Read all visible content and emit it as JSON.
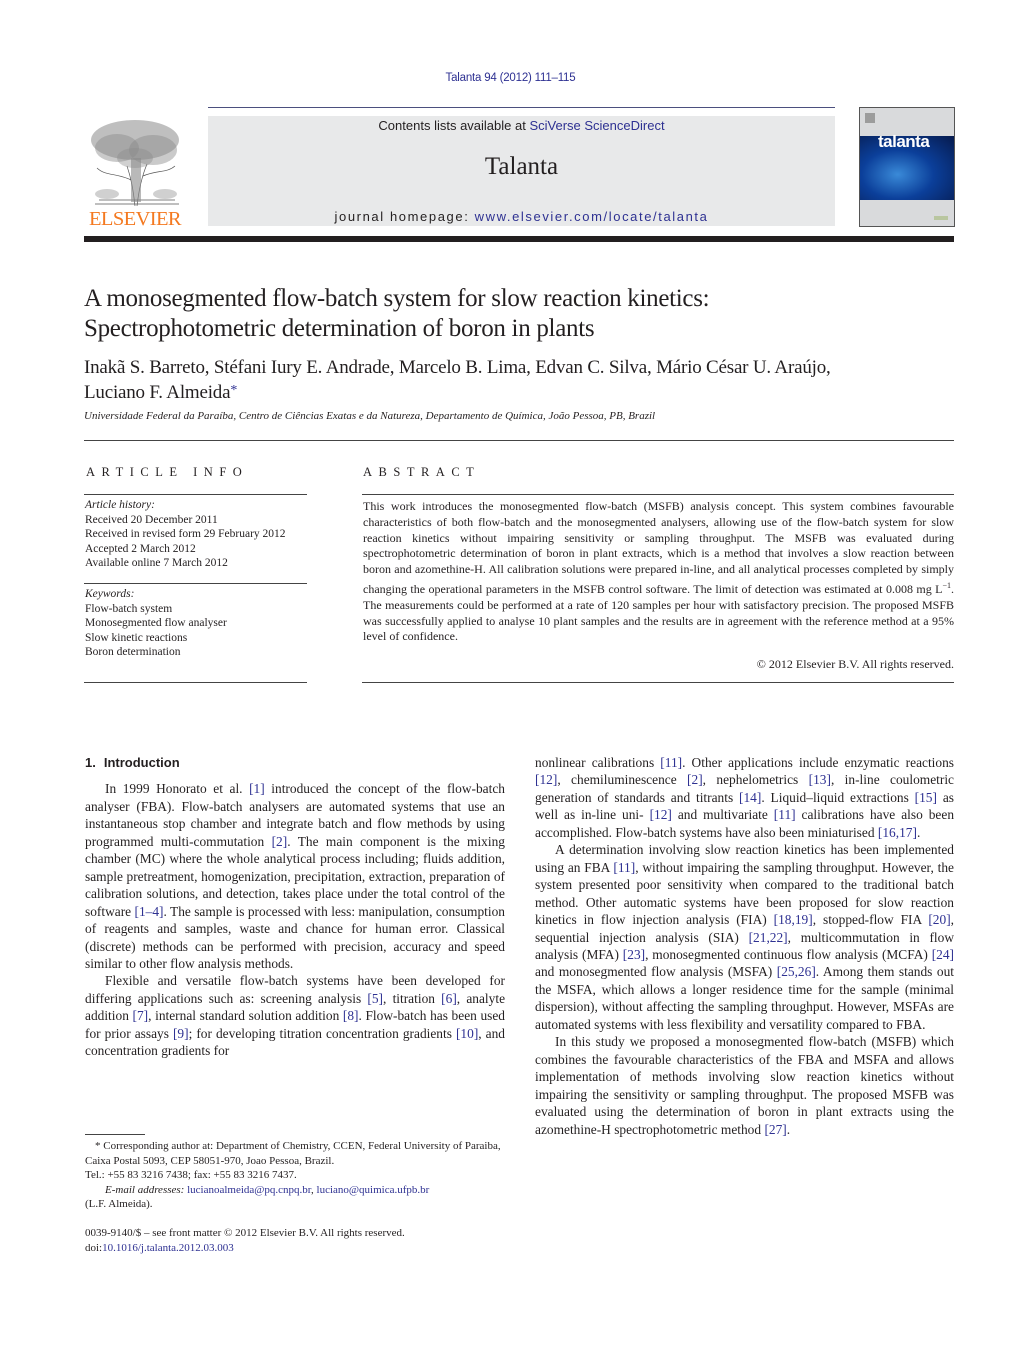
{
  "header": {
    "citation": "Talanta 94 (2012) 111–115",
    "publisher_logo_text": "ELSEVIER",
    "contents_prefix": "Contents lists available at ",
    "contents_link": "SciVerse ScienceDirect",
    "journal_name": "Talanta",
    "homepage_prefix": "journal homepage: ",
    "homepage_link": "www.elsevier.com/locate/talanta",
    "cover_title": "talanta"
  },
  "article": {
    "title_line1": "A monosegmented flow-batch system for slow reaction kinetics:",
    "title_line2": "Spectrophotometric determination of boron in plants",
    "authors_line1": "Inakã S. Barreto, Stéfani Iury E. Andrade, Marcelo B. Lima, Edvan C. Silva, Mário César U. Araújo,",
    "authors_line2": "Luciano F. Almeida",
    "corresponding_mark": "*",
    "affiliation": "Universidade Federal da Paraíba, Centro de Ciências Exatas e da Natureza, Departamento de Química, João Pessoa, PB, Brazil"
  },
  "article_info": {
    "heading": "ARTICLE INFO",
    "history_label": "Article history:",
    "history": [
      "Received 20 December 2011",
      "Received in revised form 29 February 2012",
      "Accepted 2 March 2012",
      "Available online 7 March 2012"
    ],
    "keywords_label": "Keywords:",
    "keywords": [
      "Flow-batch system",
      "Monosegmented flow analyser",
      "Slow kinetic reactions",
      "Boron determination"
    ]
  },
  "abstract": {
    "heading": "ABSTRACT",
    "text_part1": "This work introduces the monosegmented flow-batch (MSFB) analysis concept. This system combines favourable characteristics of both flow-batch and the monosegmented analysers, allowing use of the flow-batch system for slow reaction kinetics without impairing sensitivity or sampling throughput. The MSFB was evaluated during spectrophotometric determination of boron in plant extracts, which is a method that involves a slow reaction between boron and azomethine-H. All calibration solutions were prepared in-line, and all analytical processes completed by simply changing the operational parameters in the MSFB control software. The limit of detection was estimated at 0.008 mg L",
    "text_sup": "−1",
    "text_part2": ". The measurements could be performed at a rate of 120 samples per hour with satisfactory precision. The proposed MSFB was successfully applied to analyse 10 plant samples and the results are in agreement with the reference method at a 95% level of confidence.",
    "copyright": "© 2012 Elsevier B.V. All rights reserved."
  },
  "introduction": {
    "section_number": "1.",
    "heading": "Introduction",
    "p1": [
      {
        "t": "In 1999 Honorato et al. "
      },
      {
        "r": "[1]"
      },
      {
        "t": " introduced the concept of the flow-batch analyser (FBA). Flow-batch analysers are automated systems that use an instantaneous stop chamber and integrate batch and flow methods by using programmed multi-commutation "
      },
      {
        "r": "[2]"
      },
      {
        "t": ". The main component is the mixing chamber (MC) where the whole analytical process including; fluids addition, sample pretreatment, homogenization, precipitation, extraction, preparation of calibration solutions, and detection, takes place under the total control of the software "
      },
      {
        "r": "[1–4]"
      },
      {
        "t": ". The sample is processed with less: manipulation, consumption of reagents and samples, waste and chance for human error. Classical (discrete) methods can be performed with precision, accuracy and speed similar to other flow analysis methods."
      }
    ],
    "p2": [
      {
        "t": "Flexible and versatile flow-batch systems have been developed for differing applications such as: screening analysis "
      },
      {
        "r": "[5]"
      },
      {
        "t": ", titration "
      },
      {
        "r": "[6]"
      },
      {
        "t": ", analyte addition "
      },
      {
        "r": "[7]"
      },
      {
        "t": ", internal standard solution addition "
      },
      {
        "r": "[8]"
      },
      {
        "t": ". Flow-batch has been used for prior assays "
      },
      {
        "r": "[9]"
      },
      {
        "t": "; for developing titration concentration gradients "
      },
      {
        "r": "[10]"
      },
      {
        "t": ", and concentration gradients for nonlinear calibrations "
      },
      {
        "r": "[11]"
      },
      {
        "t": ". Other applications include enzymatic reactions "
      },
      {
        "r": "[12]"
      },
      {
        "t": ", chemiluminescence "
      },
      {
        "r": "[2]"
      },
      {
        "t": ", nephelometrics "
      },
      {
        "r": "[13]"
      },
      {
        "t": ", in-line coulometric generation of standards and titrants "
      },
      {
        "r": "[14]"
      },
      {
        "t": ". Liquid–liquid extractions "
      },
      {
        "r": "[15]"
      },
      {
        "t": " as well as in-line uni- "
      },
      {
        "r": "[12]"
      },
      {
        "t": " and multivariate "
      },
      {
        "r": "[11]"
      },
      {
        "t": " calibrations have also been accomplished. Flow-batch systems have also been miniaturised "
      },
      {
        "r": "[16,17]"
      },
      {
        "t": "."
      }
    ],
    "p3": [
      {
        "t": "A determination involving slow reaction kinetics has been implemented using an FBA "
      },
      {
        "r": "[11]"
      },
      {
        "t": ", without impairing the sampling throughput. However, the system presented poor sensitivity when compared to the traditional batch method. Other automatic systems have been proposed for slow reaction kinetics in flow injection analysis (FIA) "
      },
      {
        "r": "[18,19]"
      },
      {
        "t": ", stopped-flow FIA "
      },
      {
        "r": "[20]"
      },
      {
        "t": ", sequential injection analysis (SIA) "
      },
      {
        "r": "[21,22]"
      },
      {
        "t": ", multicommutation in flow analysis (MFA) "
      },
      {
        "r": "[23]"
      },
      {
        "t": ", monosegmented continuous flow analysis (MCFA) "
      },
      {
        "r": "[24]"
      },
      {
        "t": " and monosegmented flow analysis (MSFA) "
      },
      {
        "r": "[25,26]"
      },
      {
        "t": ". Among them stands out the MSFA, which allows a longer residence time for the sample (minimal dispersion), without affecting the sampling throughput. However, MSFAs are automated systems with less flexibility and versatility compared to FBA."
      }
    ],
    "p4": [
      {
        "t": "In this study we proposed a monosegmented flow-batch (MSFB) which combines the favourable characteristics of the FBA and MSFA and allows implementation of methods involving slow reaction kinetics without impairing the sensitivity or sampling throughput. The proposed MSFB was evaluated using the determination of boron in plant extracts using the azomethine-H spectrophotometric method "
      },
      {
        "r": "[27]"
      },
      {
        "t": "."
      }
    ]
  },
  "footnote": {
    "mark": "*",
    "corresponding": "Corresponding author at: Department of Chemistry, CCEN, Federal University of Paraiba, Caixa Postal 5093, CEP 58051-970, Joao Pessoa, Brazil.",
    "tel": "Tel.: +55 83 3216 7438; fax: +55 83 3216 7437.",
    "email_label": "E-mail addresses:",
    "email1": "lucianoalmeida@pq.cnpq.br",
    "email_sep": ", ",
    "email2": "luciano@quimica.ufpb.br",
    "email_owner": "(L.F. Almeida)."
  },
  "front_matter": {
    "issn_line": "0039-9140/$ – see front matter © 2012 Elsevier B.V. All rights reserved.",
    "doi_prefix": "doi:",
    "doi_link": "10.1016/j.talanta.2012.03.003"
  },
  "colors": {
    "link": "#2e3192",
    "elsevier_orange": "#f47920",
    "banner_bg": "#e8e9ea",
    "text": "#231f20"
  }
}
